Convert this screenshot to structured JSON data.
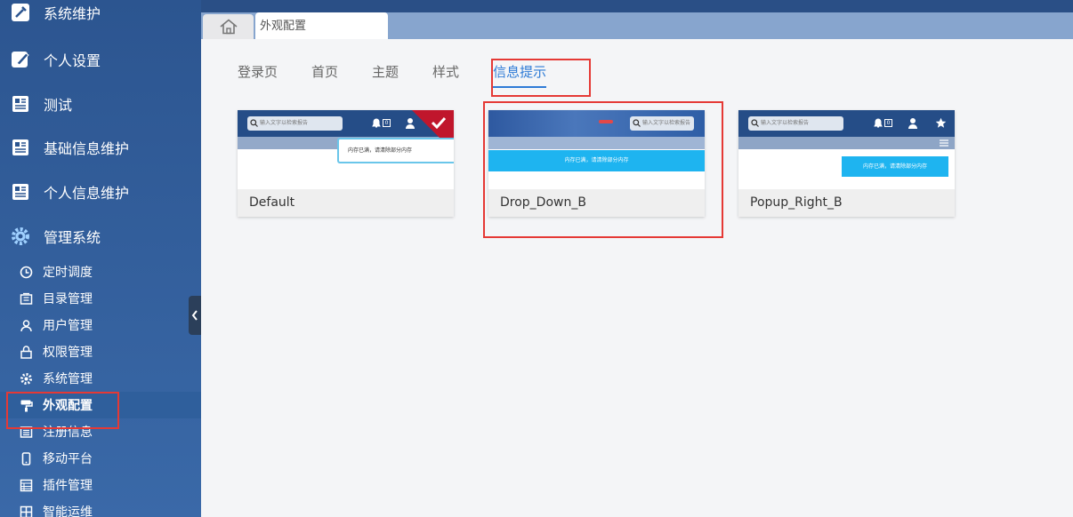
{
  "sidebar": {
    "main_items": [
      {
        "label": "系统维护",
        "icon": "wrench-icon"
      },
      {
        "label": "个人设置",
        "icon": "edit-icon"
      },
      {
        "label": "测试",
        "icon": "document-icon"
      },
      {
        "label": "基础信息维护",
        "icon": "document-icon"
      },
      {
        "label": "个人信息维护",
        "icon": "document-icon"
      },
      {
        "label": "管理系统",
        "icon": "gear-icon"
      }
    ],
    "sub_items": [
      {
        "label": "定时调度",
        "icon": "clock-icon"
      },
      {
        "label": "目录管理",
        "icon": "folder-icon"
      },
      {
        "label": "用户管理",
        "icon": "user-icon"
      },
      {
        "label": "权限管理",
        "icon": "lock-icon"
      },
      {
        "label": "系统管理",
        "icon": "gear-icon"
      },
      {
        "label": "外观配置",
        "icon": "paint-roller-icon"
      },
      {
        "label": "注册信息",
        "icon": "list-icon"
      },
      {
        "label": "移动平台",
        "icon": "mobile-icon"
      },
      {
        "label": "插件管理",
        "icon": "list-icon"
      },
      {
        "label": "智能运维",
        "icon": "grid-icon"
      }
    ],
    "active_sub": "外观配置"
  },
  "tabs": {
    "home_icon": "home-icon",
    "current": "外观配置"
  },
  "subnav": [
    "登录页",
    "首页",
    "主题",
    "样式",
    "信息提示"
  ],
  "subnav_active": "信息提示",
  "cards": [
    {
      "name": "Default",
      "search_placeholder": "输入文字以检索报告",
      "badge": "0",
      "message": "内存已满，请清除部分内存",
      "selected": true
    },
    {
      "name": "Drop_Down_B",
      "search_placeholder": "输入文字以检索报告",
      "message": "内存已满，请清除部分内存",
      "selected": false
    },
    {
      "name": "Popup_Right_B",
      "search_placeholder": "输入文字以检索报告",
      "badge": "0",
      "message": "内存已满，请清除部分内存",
      "selected": false
    }
  ],
  "colors": {
    "sidebar": "#2c5590",
    "accent": "#2e7bd6",
    "highlight": "#e53935",
    "preview_header": "#254d87",
    "notice_blue": "#1eb4f0"
  }
}
